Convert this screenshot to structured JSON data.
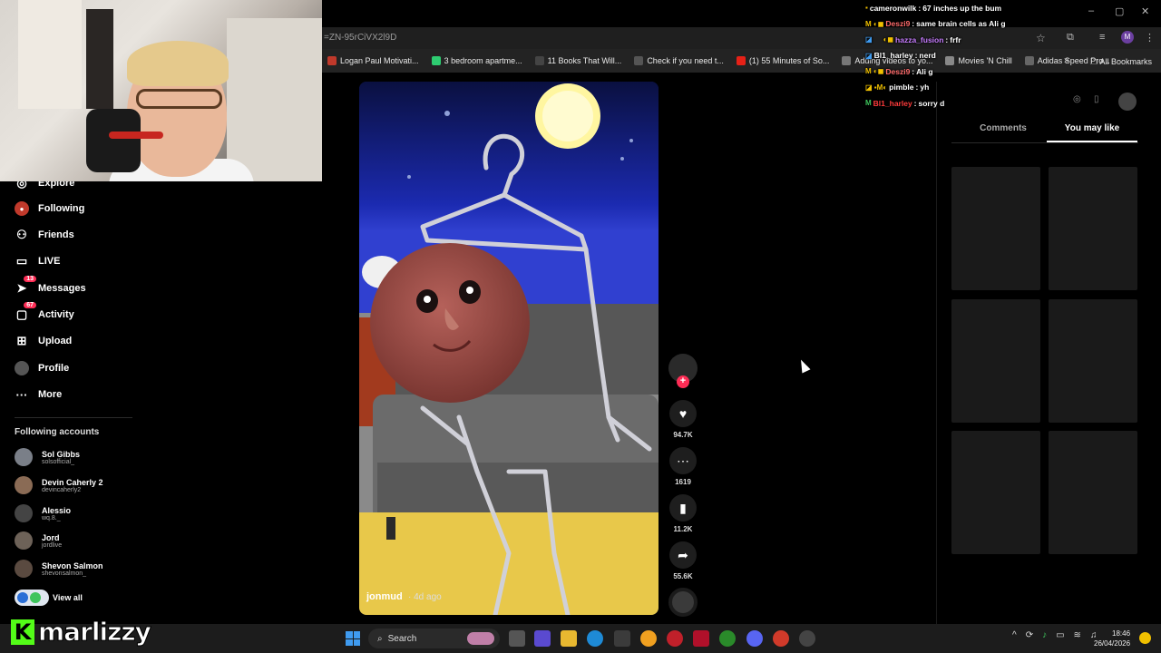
{
  "browser": {
    "url_fragment": "=ZN-95rCiVX2l9D",
    "bookmarks": [
      {
        "label": "Logan Paul Motivati..."
      },
      {
        "label": "3 bedroom apartme..."
      },
      {
        "label": "11 Books That Will..."
      },
      {
        "label": "Check if you need t..."
      },
      {
        "label": "(1) 55 Minutes of So..."
      },
      {
        "label": "Adding videos to yo..."
      },
      {
        "label": "Movies 'N Chill"
      },
      {
        "label": "Adidas Speed Pro..."
      }
    ],
    "all_bookmarks_label": "All Bookmarks",
    "more_label": "»"
  },
  "nav": {
    "items": [
      {
        "label": "Explore",
        "icon": "compass-icon"
      },
      {
        "label": "Following",
        "icon": "following-icon"
      },
      {
        "label": "Friends",
        "icon": "friends-icon"
      },
      {
        "label": "LIVE",
        "icon": "live-icon"
      },
      {
        "label": "Messages",
        "icon": "messages-icon",
        "badge": "13"
      },
      {
        "label": "Activity",
        "icon": "activity-icon",
        "badge": "67"
      },
      {
        "label": "Upload",
        "icon": "upload-icon"
      },
      {
        "label": "Profile",
        "icon": "profile-icon"
      },
      {
        "label": "More",
        "icon": "more-icon"
      }
    ],
    "following_accounts_title": "Following accounts",
    "accounts": [
      {
        "name": "Sol Gibbs",
        "handle": "solsofficial_"
      },
      {
        "name": "Devin Caherly 2",
        "handle": "devincaherly2"
      },
      {
        "name": "Alessio",
        "handle": "wq.8._"
      },
      {
        "name": "Jord",
        "handle": "jordlive"
      },
      {
        "name": "Shevon Salmon",
        "handle": "shevonsalmon_"
      }
    ],
    "view_all": "View all"
  },
  "video": {
    "author": "jonmud",
    "time": "· 4d ago",
    "likes": "94.7K",
    "comments": "1619",
    "saves": "11.2K",
    "shares": "55.6K"
  },
  "side_panel": {
    "tab_comments": "Comments",
    "tab_you_may_like": "You may like"
  },
  "chat": [
    {
      "user": "cameronwilk",
      "msg": "67 inches up the bum",
      "color": "#ffffff"
    },
    {
      "user": "Deszi9",
      "msg": "same brain cells as Ali g",
      "color": "#ff5a5a"
    },
    {
      "user": "hazza_fusion",
      "msg": "frfr",
      "color": "#c06cff"
    },
    {
      "user": "Bl1_harley",
      "msg": "nerd",
      "color": "#ffffff"
    },
    {
      "user": "Deszi9",
      "msg": "Ali g",
      "color": "#ff5a5a"
    },
    {
      "user": "pimble",
      "msg": "yh",
      "color": "#ffffff"
    },
    {
      "user": "Bl1_harley",
      "msg": "sorry d",
      "color": "#ff3030"
    }
  ],
  "taskbar": {
    "search_label": "Search",
    "time": "18:46",
    "date": "26/04/2026"
  },
  "stream_logo": {
    "k": "K",
    "name": "marlizzy"
  },
  "colors": {
    "accent": "#fe2c55",
    "kick_green": "#53fc18",
    "background": "#000000"
  }
}
